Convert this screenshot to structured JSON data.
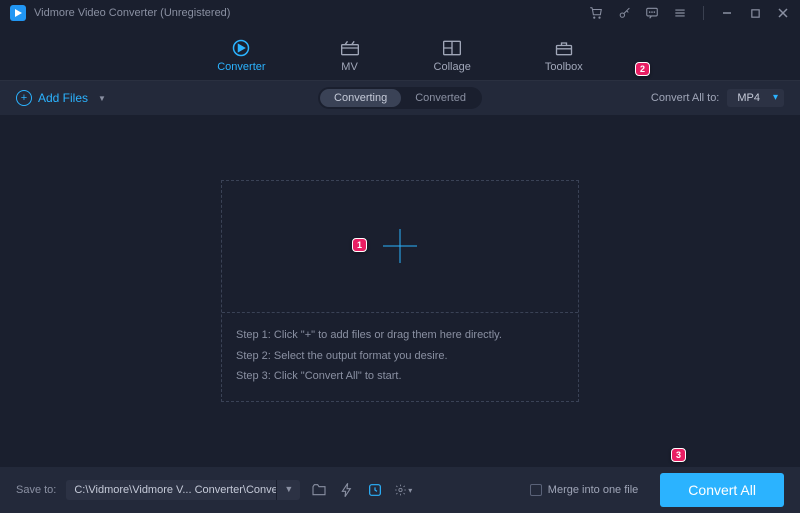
{
  "title": "Vidmore Video Converter (Unregistered)",
  "nav": {
    "converter": "Converter",
    "mv": "MV",
    "collage": "Collage",
    "toolbox": "Toolbox"
  },
  "toolbar": {
    "add_files": "Add Files",
    "segment_converting": "Converting",
    "segment_converted": "Converted",
    "convert_all_to": "Convert All to:",
    "format": "MP4"
  },
  "steps": {
    "s1": "Step 1: Click \"+\" to add files or drag them here directly.",
    "s2": "Step 2: Select the output format you desire.",
    "s3": "Step 3: Click \"Convert All\" to start."
  },
  "bottom": {
    "save_to": "Save to:",
    "path": "C:\\Vidmore\\Vidmore V... Converter\\Converted",
    "merge": "Merge into one file",
    "convert_all": "Convert All"
  },
  "badges": {
    "b1": "1",
    "b2": "2",
    "b3": "3"
  }
}
